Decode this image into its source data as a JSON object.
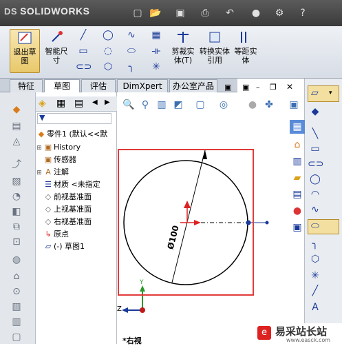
{
  "app": {
    "brand": "SOLIDWORKS",
    "brand_prefix": "DS"
  },
  "quick_access": [
    "new-icon",
    "open-icon",
    "save-icon",
    "print-icon",
    "undo-icon",
    "rebuild-icon",
    "options-icon",
    "help-icon"
  ],
  "ribbon": {
    "exit_sketch": "退出草图",
    "smart_dimension": "智能尺寸",
    "trim_entities": "剪裁实体(T)",
    "convert_entities": "转换实体引用",
    "offset_entities": "等距实体"
  },
  "tabs": [
    "特征",
    "草图",
    "评估",
    "DimXpert",
    "办公室产品"
  ],
  "active_tab": "草图",
  "feature_tree": {
    "part": "零件1 (默认<<默",
    "items": [
      {
        "label": "History",
        "icon": "history-icon",
        "expandable": true
      },
      {
        "label": "传感器",
        "icon": "sensor-icon",
        "expandable": false
      },
      {
        "label": "注解",
        "icon": "annotation-icon",
        "expandable": true
      },
      {
        "label": "材质 <未指定",
        "icon": "material-icon",
        "expandable": false
      },
      {
        "label": "前视基准面",
        "icon": "plane-icon",
        "expandable": false
      },
      {
        "label": "上视基准面",
        "icon": "plane-icon",
        "expandable": false
      },
      {
        "label": "右视基准面",
        "icon": "plane-icon",
        "expandable": false
      },
      {
        "label": "原点",
        "icon": "origin-icon",
        "expandable": false
      },
      {
        "label": "(-) 草图1",
        "icon": "sketch-icon",
        "expandable": false
      }
    ]
  },
  "sketch": {
    "dimension": "Ø100",
    "view_label": "*右视"
  },
  "axes": {
    "y": "Y",
    "z": "Z"
  },
  "watermark": {
    "text": "易采站长站",
    "url": "www.easck.com"
  },
  "colors": {
    "selection": "#e23a3a",
    "accent": "#1a3a9a"
  }
}
